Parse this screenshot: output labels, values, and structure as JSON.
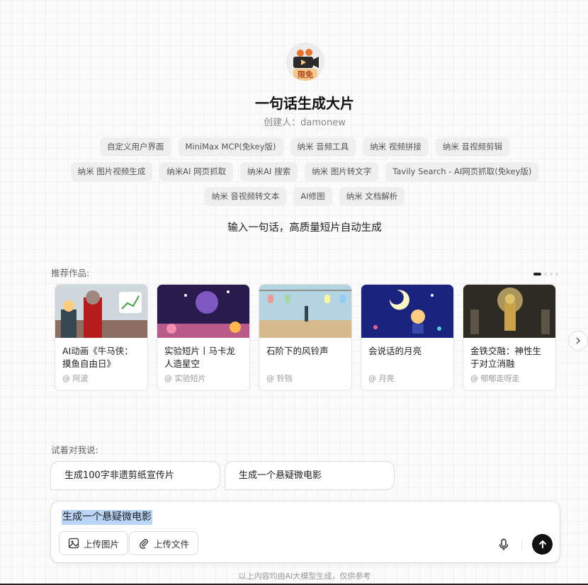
{
  "agent": {
    "badge": "限免",
    "title": "一句话生成大片",
    "creator": "创建人：damonew",
    "description": "输入一句话，高质量短片自动生成"
  },
  "tags": [
    "自定义用户界面",
    "MiniMax MCP(免key版)",
    "纳米 音频工具",
    "纳米 视频拼接",
    "纳米 音视频剪辑",
    "纳米 图片视频生成",
    "纳米AI 网页抓取",
    "纳米AI 搜索",
    "纳米 图片转文字",
    "Tavily Search - AI网页抓取(免key版)",
    "纳米 音视频转文本",
    "AI修图",
    "纳米 文档解析"
  ],
  "recommended": {
    "label": "推荐作品:",
    "cards": [
      {
        "title": "AI动画《牛马侠：摸鱼自由日》",
        "author": "@ 阿波"
      },
      {
        "title": "实验短片丨马卡龙人造星空",
        "author": "@ 实验短片"
      },
      {
        "title": "石阶下的风铃声",
        "author": "@ 铃铛"
      },
      {
        "title": "会说话的月亮",
        "author": "@ 月亮"
      },
      {
        "title": "金铁交融：神性生于对立消融",
        "author": "@ 郇郇走呀走"
      }
    ]
  },
  "suggest": {
    "label": "试着对我说:",
    "items": [
      "生成100字非遗剪纸宣传片",
      "生成一个悬疑微电影"
    ]
  },
  "composer": {
    "text": "生成一个悬疑微电影",
    "upload_image": "上传图片",
    "upload_file": "上传文件"
  },
  "footer": "以上内容均由AI大模型生成，仅供参考",
  "colors": {
    "accent": "#111111",
    "tag_bg": "#efefef",
    "badge_bg": "#f7c88b"
  }
}
